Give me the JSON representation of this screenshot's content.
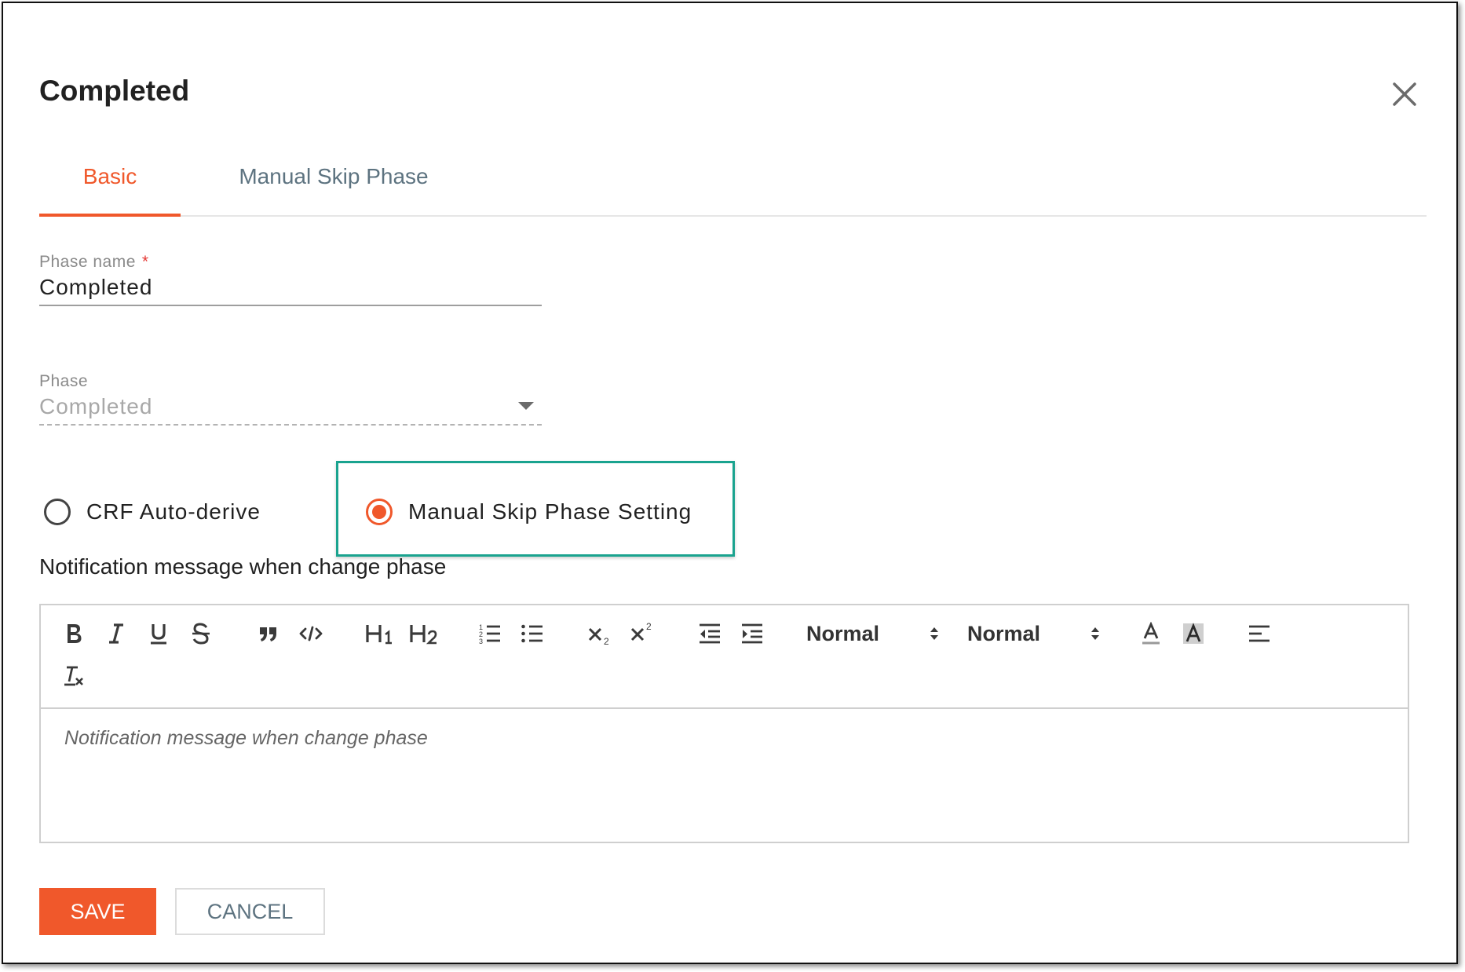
{
  "dialog": {
    "title": "Completed",
    "close_icon": "close-icon"
  },
  "tabs": [
    {
      "label": "Basic",
      "active": true
    },
    {
      "label": "Manual Skip Phase",
      "active": false
    }
  ],
  "form": {
    "phase_name": {
      "label": "Phase name",
      "required_mark": "*",
      "value": "Completed"
    },
    "phase": {
      "label": "Phase",
      "value": "Completed",
      "disabled": true
    }
  },
  "radios": [
    {
      "label": "CRF Auto-derive",
      "checked": false
    },
    {
      "label": "Manual Skip Phase Setting",
      "checked": true
    }
  ],
  "notification": {
    "label": "Notification message when change phase",
    "placeholder": "Notification message when change phase",
    "toolbar": {
      "font_size": "Normal",
      "header": "Normal",
      "icons": [
        "bold-icon",
        "italic-icon",
        "underline-icon",
        "strikethrough-icon",
        "blockquote-icon",
        "code-icon",
        "heading1-icon",
        "heading2-icon",
        "ordered-list-icon",
        "bullet-list-icon",
        "subscript-icon",
        "superscript-icon",
        "outdent-icon",
        "indent-icon",
        "font-color-icon",
        "background-color-icon",
        "align-icon",
        "clear-format-icon"
      ]
    }
  },
  "buttons": {
    "save": "SAVE",
    "cancel": "CANCEL"
  },
  "colors": {
    "accent": "#f0582b",
    "highlight": "#1aa38f",
    "tab_inactive": "#5d7380"
  }
}
